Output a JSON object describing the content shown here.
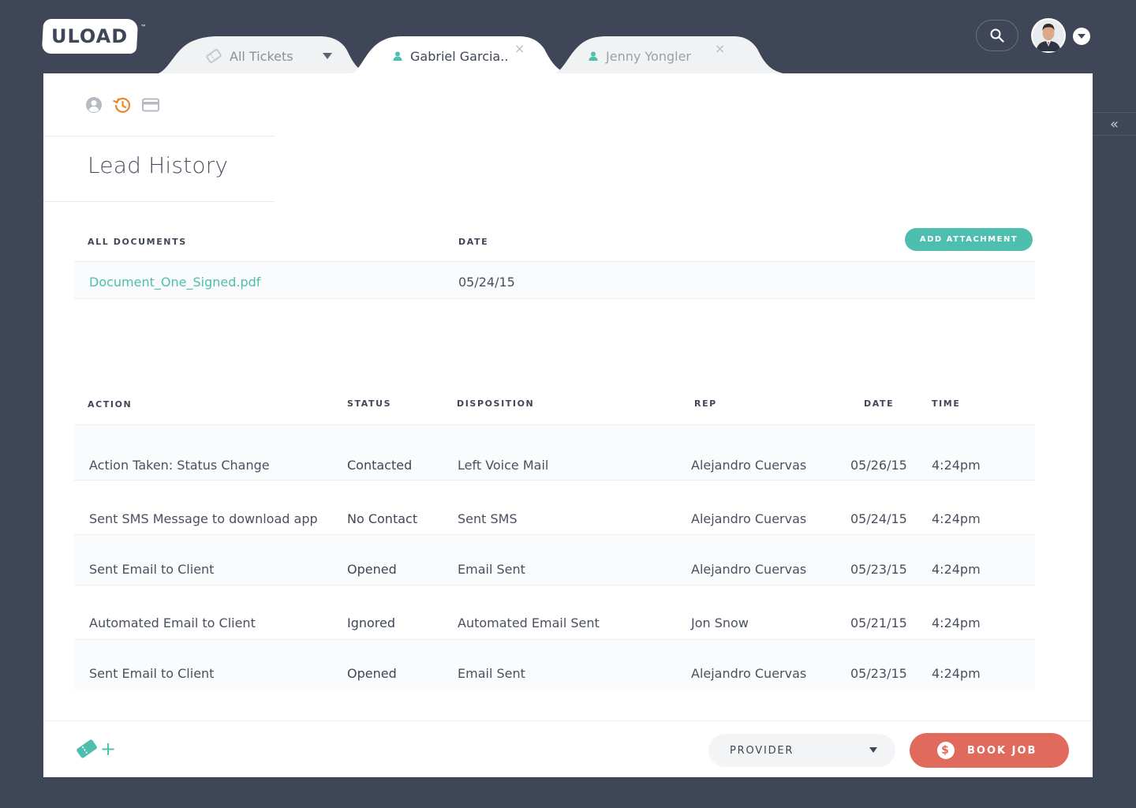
{
  "brand": {
    "logo_text": "ULOAD",
    "trademark": "™"
  },
  "tabs": [
    {
      "label": "All Tickets"
    },
    {
      "label": "Gabriel Garcia..",
      "close": "×"
    },
    {
      "label": "Jenny Yongler",
      "close": "×"
    }
  ],
  "header": {
    "collapse_glyph": "«"
  },
  "page": {
    "title": "Lead History"
  },
  "documents": {
    "columns": [
      "ALL DOCUMENTS",
      "DATE"
    ],
    "add_button": "ADD ATTACHMENT",
    "rows": [
      {
        "name": "Document_One_Signed.pdf",
        "date": "05/24/15"
      }
    ]
  },
  "history": {
    "columns": [
      "ACTION",
      "STATUS",
      "DISPOSITION",
      "REP",
      "DATE",
      "TIME"
    ],
    "rows": [
      {
        "action": "Action Taken: Status Change",
        "status": "Contacted",
        "disposition": "Left Voice Mail",
        "rep": "Alejandro Cuervas",
        "date": "05/26/15",
        "time": "4:24pm"
      },
      {
        "action": "Sent SMS Message to download app",
        "status": "No Contact",
        "disposition": "Sent SMS",
        "rep": "Alejandro Cuervas",
        "date": "05/24/15",
        "time": "4:24pm"
      },
      {
        "action": "Sent Email to Client",
        "status": "Opened",
        "disposition": "Email Sent",
        "rep": "Alejandro Cuervas",
        "date": "05/23/15",
        "time": "4:24pm"
      },
      {
        "action": "Automated Email to Client",
        "status": "Ignored",
        "disposition": "Automated Email Sent",
        "rep": "Jon Snow",
        "date": "05/21/15",
        "time": "4:24pm"
      },
      {
        "action": "Sent Email to Client",
        "status": "Opened",
        "disposition": "Email Sent",
        "rep": "Alejandro Cuervas",
        "date": "05/23/15",
        "time": "4:24pm"
      }
    ]
  },
  "footer": {
    "add_glyph": "+",
    "provider_label": "PROVIDER",
    "book_label": "BOOK JOB",
    "book_icon_glyph": "$"
  },
  "colors": {
    "background": "#3f4658",
    "accent_teal": "#4ebfae",
    "accent_orange": "#e8892c",
    "book_red": "#e06a5c"
  }
}
